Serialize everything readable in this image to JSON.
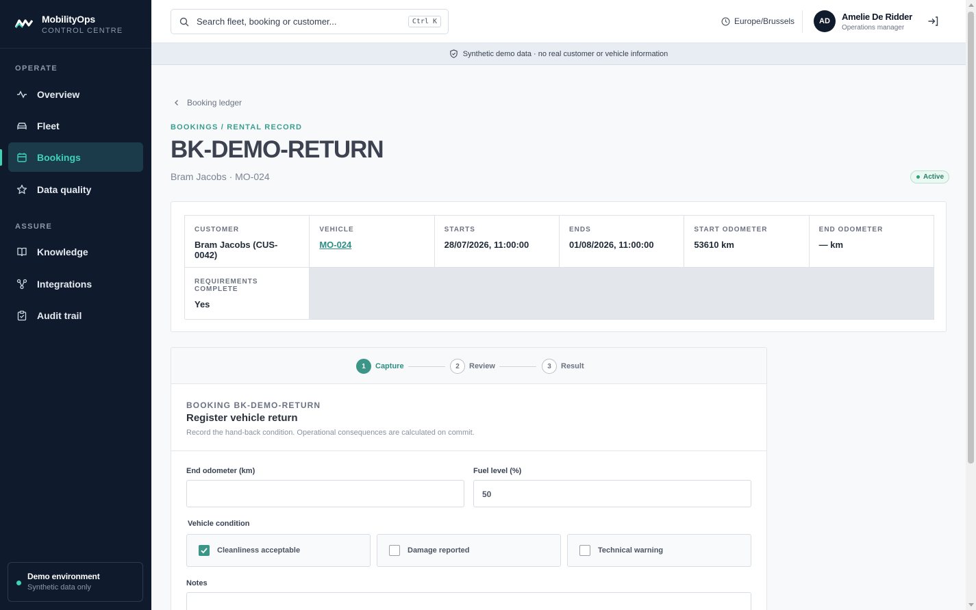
{
  "brand": {
    "name": "MobilityOps",
    "subtitle": "CONTROL CENTRE"
  },
  "sidebar": {
    "sections": [
      {
        "label": "OPERATE"
      },
      {
        "label": "ASSURE"
      }
    ],
    "items": [
      {
        "label": "Overview",
        "icon": "activity-icon"
      },
      {
        "label": "Fleet",
        "icon": "car-icon"
      },
      {
        "label": "Bookings",
        "icon": "calendar-icon",
        "active": true
      },
      {
        "label": "Data quality",
        "icon": "star-icon"
      },
      {
        "label": "Knowledge",
        "icon": "book-icon"
      },
      {
        "label": "Integrations",
        "icon": "network-icon"
      },
      {
        "label": "Audit trail",
        "icon": "clipboard-check-icon"
      }
    ],
    "environment": {
      "title": "Demo environment",
      "subtitle": "Synthetic data only"
    }
  },
  "topbar": {
    "search_placeholder": "Search fleet, booking or customer...",
    "shortcut": "Ctrl K",
    "timezone": "Europe/Brussels",
    "user": {
      "initials": "AD",
      "name": "Amelie De Ridder",
      "role": "Operations manager"
    }
  },
  "banner": "Synthetic demo data · no real customer or vehicle information",
  "page": {
    "back_link": "Booking ledger",
    "eyebrow": "BOOKINGS / RENTAL RECORD",
    "title": "BK-DEMO-RETURN",
    "subtitle": "Bram Jacobs · MO-024",
    "status": "Active"
  },
  "details": [
    {
      "label": "CUSTOMER",
      "value": "Bram Jacobs (CUS-0042)"
    },
    {
      "label": "VEHICLE",
      "value": "MO-024"
    },
    {
      "label": "STARTS",
      "value": "28/07/2026, 11:00:00"
    },
    {
      "label": "ENDS",
      "value": "01/08/2026, 11:00:00"
    },
    {
      "label": "START ODOMETER",
      "value": "53610 km"
    },
    {
      "label": "END ODOMETER",
      "value": "— km"
    },
    {
      "label": "REQUIREMENTS COMPLETE",
      "value": "Yes"
    }
  ],
  "wizard": {
    "steps": [
      {
        "num": "1",
        "label": "Capture",
        "active": true
      },
      {
        "num": "2",
        "label": "Review"
      },
      {
        "num": "3",
        "label": "Result"
      }
    ],
    "eyebrow": "BOOKING BK-DEMO-RETURN",
    "title": "Register vehicle return",
    "description": "Record the hand-back condition. Operational consequences are calculated on commit.",
    "fields": {
      "end_odometer": {
        "label": "End odometer (km)",
        "value": ""
      },
      "fuel_level": {
        "label": "Fuel level (%)",
        "value": "50"
      }
    },
    "condition_label": "Vehicle condition",
    "conditions": [
      {
        "label": "Cleanliness acceptable",
        "checked": true
      },
      {
        "label": "Damage reported",
        "checked": false
      },
      {
        "label": "Technical warning",
        "checked": false
      }
    ],
    "notes_label": "Notes",
    "notes_value": ""
  },
  "colors": {
    "accent": "#3ed3b7",
    "teal": "#3c9688",
    "sidebar_bg": "#0f1b2d"
  }
}
